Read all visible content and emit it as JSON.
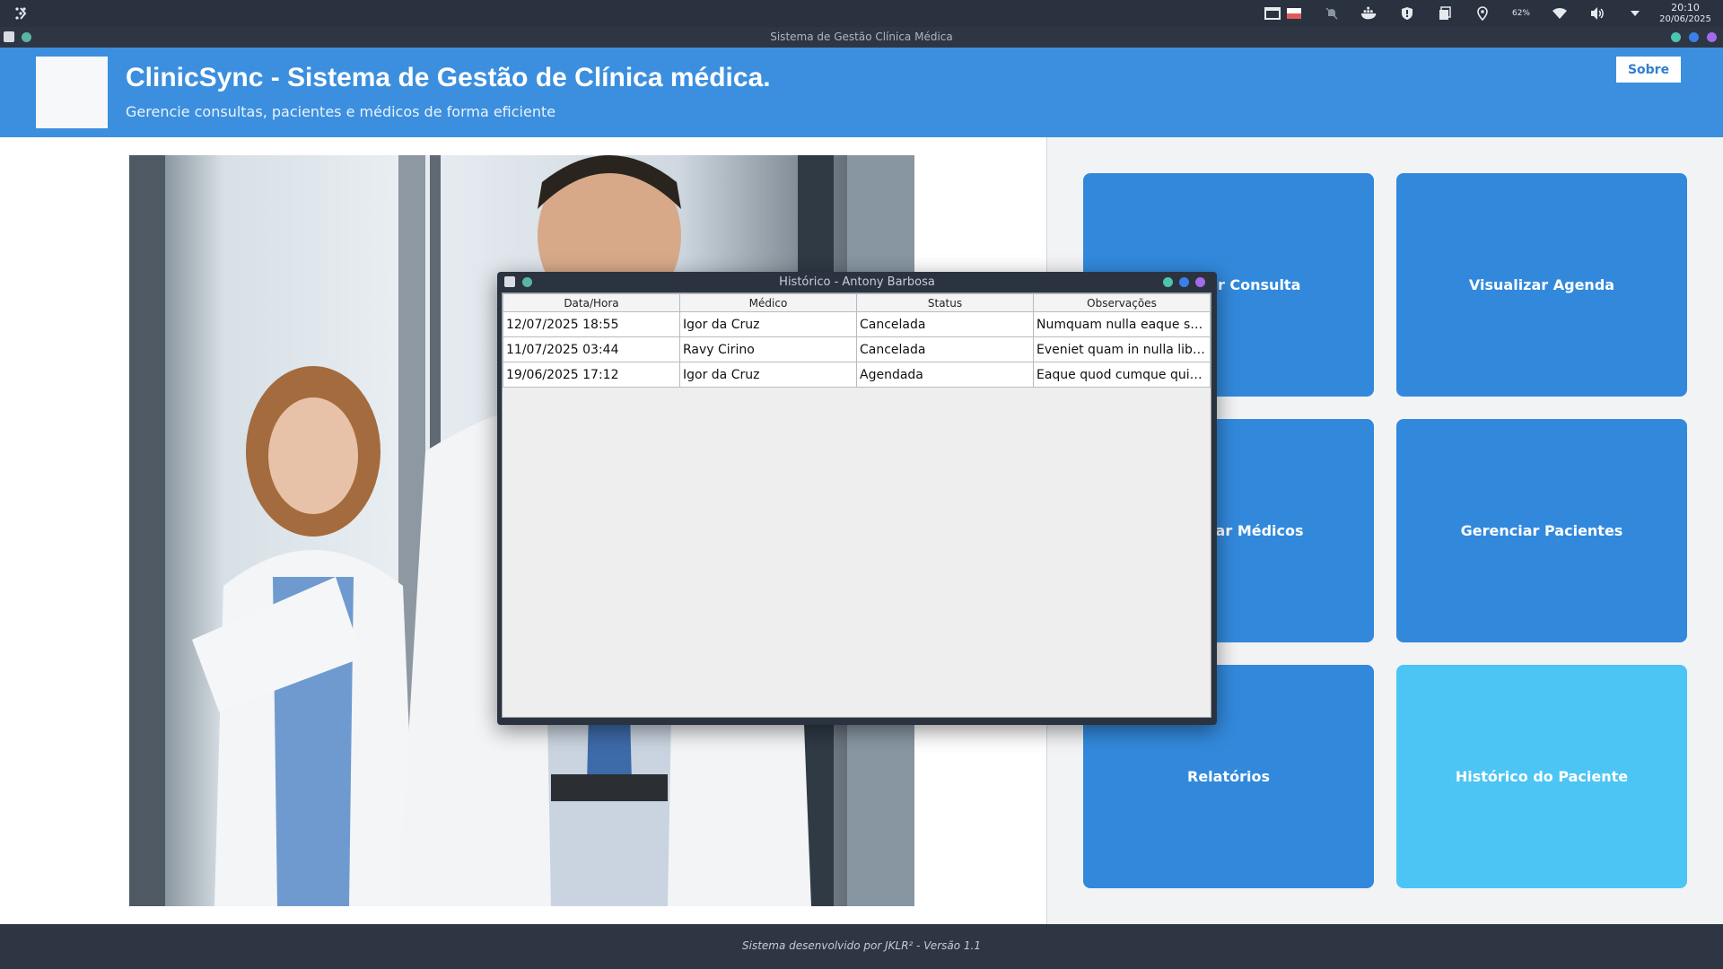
{
  "system_bar": {
    "tray_icons": [
      "screen-icon",
      "flag-icon",
      "bell-off-icon",
      "docker-icon",
      "shield-icon",
      "clipboard-icon",
      "location-icon",
      "battery-icon",
      "wifi-icon",
      "volume-icon",
      "chevron-down-icon"
    ],
    "battery_label": "62%",
    "time": "20:10",
    "date": "20/06/2025"
  },
  "window": {
    "title": "Sistema de Gestão Clínica Médica",
    "control_colors": [
      "#4dc4b0",
      "#3b7fe8",
      "#a26be8"
    ]
  },
  "header": {
    "title": "ClinicSync - Sistema de Gestão de Clínica médica.",
    "subtitle": "Gerencie consultas, pacientes e médicos de forma eficiente",
    "about_button": "Sobre"
  },
  "menu": {
    "tiles": [
      {
        "label": "Agendar Consulta"
      },
      {
        "label": "Visualizar Agenda"
      },
      {
        "label": "Gerenciar Médicos"
      },
      {
        "label": "Gerenciar Pacientes"
      },
      {
        "label": "Relatórios"
      },
      {
        "label": "Histórico do Paciente",
        "selected": true
      }
    ],
    "colors": {
      "tile": "#3289dc",
      "tile_selected": "#4cc5f5"
    }
  },
  "dialog": {
    "title": "Histórico - Antony Barbosa",
    "columns": [
      "Data/Hora",
      "Médico",
      "Status",
      "Observações"
    ],
    "rows": [
      [
        "12/07/2025 18:55",
        "Igor da Cruz",
        "Cancelada",
        "Numquam nulla eaque sol..."
      ],
      [
        "11/07/2025 03:44",
        "Ravy Cirino",
        "Cancelada",
        "Eveniet quam in nulla liber..."
      ],
      [
        "19/06/2025 17:12",
        "Igor da Cruz",
        "Agendada",
        "Eaque quod cumque quia ..."
      ]
    ]
  },
  "footer": {
    "text": "Sistema desenvolvido por JKLR² - Versão 1.1"
  }
}
